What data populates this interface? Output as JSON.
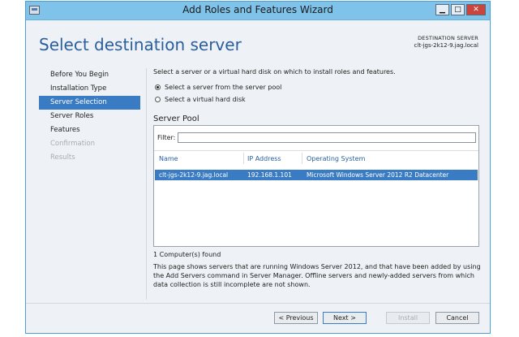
{
  "window": {
    "title": "Add Roles and Features Wizard",
    "minimize": "▁",
    "maximize": "□",
    "close": "✕"
  },
  "header": {
    "title": "Select destination server",
    "dest_label": "DESTINATION SERVER",
    "dest_value": "clt-jgs-2k12-9.jag.local"
  },
  "nav": [
    {
      "label": "Before You Begin",
      "state": "normal"
    },
    {
      "label": "Installation Type",
      "state": "normal"
    },
    {
      "label": "Server Selection",
      "state": "active"
    },
    {
      "label": "Server Roles",
      "state": "normal"
    },
    {
      "label": "Features",
      "state": "normal"
    },
    {
      "label": "Confirmation",
      "state": "disabled"
    },
    {
      "label": "Results",
      "state": "disabled"
    }
  ],
  "content": {
    "instruction": "Select a server or a virtual hard disk on which to install roles and features.",
    "radio_pool": "Select a server from the server pool",
    "radio_vhd": "Select a virtual hard disk",
    "pool_title": "Server Pool",
    "filter_label": "Filter:",
    "filter_value": "",
    "columns": [
      "Name",
      "IP Address",
      "Operating System"
    ],
    "rows": [
      {
        "name": "clt-jgs-2k12-9.jag.local",
        "ip": "192.168.1.101",
        "os": "Microsoft Windows Server 2012 R2 Datacenter"
      }
    ],
    "count": "1 Computer(s) found",
    "description": "This page shows servers that are running Windows Server 2012, and that have been added by using the Add Servers command in Server Manager. Offline servers and newly-added servers from which data collection is still incomplete are not shown."
  },
  "buttons": {
    "previous": "< Previous",
    "next": "Next >",
    "install": "Install",
    "cancel": "Cancel"
  }
}
